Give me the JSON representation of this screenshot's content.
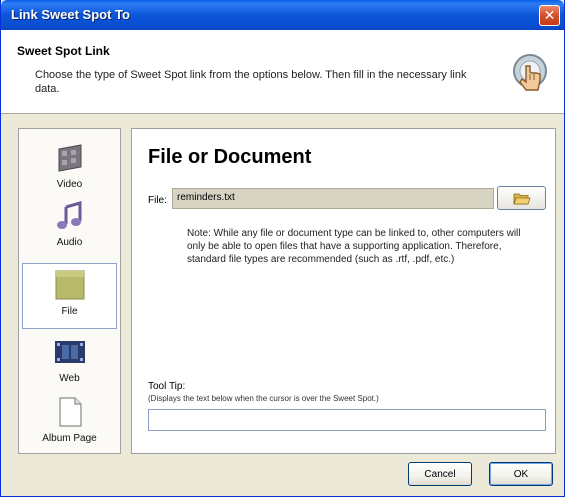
{
  "window": {
    "title": "Link Sweet Spot To",
    "close_glyph": "✕"
  },
  "header": {
    "title": "Sweet Spot Link",
    "description": "Choose the type of Sweet Spot link from the options below. Then fill in the necessary link data.",
    "icon": "pointer-hand-icon"
  },
  "sidebar": {
    "items": [
      {
        "label": "Video",
        "icon": "video-film-icon",
        "selected": false
      },
      {
        "label": "Audio",
        "icon": "music-note-icon",
        "selected": false
      },
      {
        "label": "File",
        "icon": "folder-icon",
        "selected": true
      },
      {
        "label": "Web",
        "icon": "web-film-icon",
        "selected": false
      },
      {
        "label": "Album Page",
        "icon": "page-icon",
        "selected": false
      }
    ]
  },
  "content": {
    "title": "File or Document",
    "file_label": "File:",
    "file_value": "reminders.txt",
    "browse_icon": "open-folder-icon",
    "note": "Note: While any file or document type can be linked to, other computers will only be able to open files that have a supporting application.  Therefore, standard file types are recommended (such as .rtf, .pdf, etc.)",
    "tooltip_label": "Tool Tip:",
    "tooltip_hint": "(Displays the text below when the cursor is over the Sweet Spot.)",
    "tooltip_value": ""
  },
  "buttons": {
    "cancel": "Cancel",
    "ok": "OK"
  },
  "colors": {
    "titlebar": "#0b56d9",
    "close": "#d8532f",
    "window_bg": "#ece9d8",
    "folder": "#b8b96b"
  }
}
